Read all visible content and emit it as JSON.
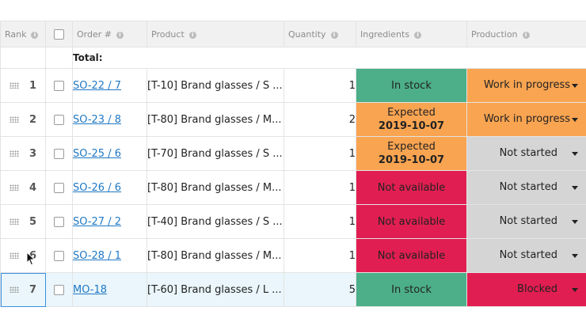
{
  "headers": {
    "rank": "Rank",
    "order": "Order #",
    "product": "Product",
    "quantity": "Quantity",
    "ingredients": "Ingredients",
    "production": "Production",
    "info_glyph": "i"
  },
  "total_label": "Total:",
  "rows": [
    {
      "rank": "1",
      "order": "SO-22 / 7",
      "product": "[T-10] Brand glasses / S ...",
      "quantity": "1",
      "ingredients": {
        "text": "In stock",
        "date": "",
        "status": "in-stock",
        "color": "#4caf89"
      },
      "production": {
        "text": "Work in progress",
        "status": "in-progress",
        "color": "#f9a451"
      }
    },
    {
      "rank": "2",
      "order": "SO-23 / 8",
      "product": "[T-80] Brand glasses / M...",
      "quantity": "2",
      "ingredients": {
        "text": "Expected",
        "date": "2019-10-07",
        "status": "expected",
        "color": "#f9a451"
      },
      "production": {
        "text": "Work in progress",
        "status": "in-progress",
        "color": "#f9a451"
      }
    },
    {
      "rank": "3",
      "order": "SO-25 / 6",
      "product": "[T-70] Brand glasses / S ...",
      "quantity": "1",
      "ingredients": {
        "text": "Expected",
        "date": "2019-10-07",
        "status": "expected",
        "color": "#f9a451"
      },
      "production": {
        "text": "Not started",
        "status": "not-started",
        "color": "#d5d5d5"
      }
    },
    {
      "rank": "4",
      "order": "SO-26 / 6",
      "product": "[T-80] Brand glasses / M...",
      "quantity": "1",
      "ingredients": {
        "text": "Not available",
        "date": "",
        "status": "not-available",
        "color": "#e11e51"
      },
      "production": {
        "text": "Not started",
        "status": "not-started",
        "color": "#d5d5d5"
      }
    },
    {
      "rank": "5",
      "order": "SO-27 / 2",
      "product": "[T-40] Brand glasses / S ...",
      "quantity": "1",
      "ingredients": {
        "text": "Not available",
        "date": "",
        "status": "not-available",
        "color": "#e11e51"
      },
      "production": {
        "text": "Not started",
        "status": "not-started",
        "color": "#d5d5d5"
      }
    },
    {
      "rank": "6",
      "order": "SO-28 / 1",
      "product": "[T-80] Brand glasses / M...",
      "quantity": "1",
      "ingredients": {
        "text": "Not available",
        "date": "",
        "status": "not-available",
        "color": "#e11e51"
      },
      "production": {
        "text": "Not started",
        "status": "not-started",
        "color": "#d5d5d5"
      }
    },
    {
      "rank": "7",
      "order": "MO-18",
      "product": "[T-60] Brand glasses / L ...",
      "quantity": "5",
      "ingredients": {
        "text": "In stock",
        "date": "",
        "status": "in-stock",
        "color": "#4caf89"
      },
      "production": {
        "text": "Blocked",
        "status": "blocked",
        "color": "#e11e51"
      },
      "selected": true
    }
  ]
}
